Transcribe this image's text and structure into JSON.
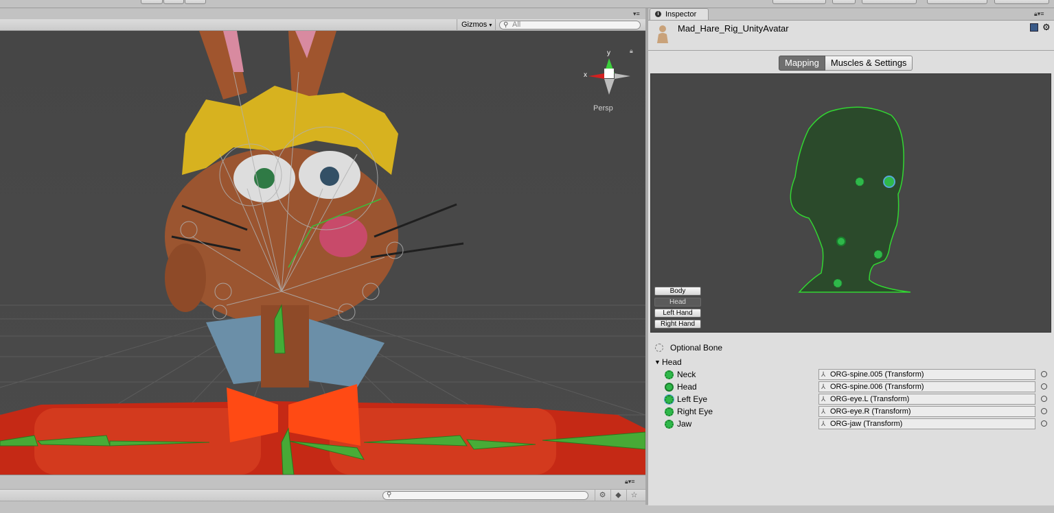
{
  "scene": {
    "gizmos_label": "Gizmos",
    "search_placeholder": "All",
    "persp_label": "Persp",
    "axis_x": "x",
    "axis_y": "y"
  },
  "inspector": {
    "tab_label": "Inspector",
    "object_name": "Mad_Hare_Rig_UnityAvatar",
    "tabs": [
      "Mapping",
      "Muscles & Settings"
    ],
    "active_tab": "Mapping",
    "body_parts": [
      "Body",
      "Head",
      "Left Hand",
      "Right Hand"
    ],
    "active_body_part": "Head",
    "optional_bone_label": "Optional Bone",
    "group_label": "Head",
    "bones": [
      {
        "label": "Neck",
        "value": "ORG-spine.005 (Transform)"
      },
      {
        "label": "Head",
        "value": "ORG-spine.006 (Transform)"
      },
      {
        "label": "Left Eye",
        "value": "ORG-eye.L (Transform)"
      },
      {
        "label": "Right Eye",
        "value": "ORG-eye.R (Transform)"
      },
      {
        "label": "Jaw",
        "value": "ORG-jaw (Transform)"
      }
    ]
  },
  "colors": {
    "accent_green": "#2fb84a",
    "selected_blue": "#57a7d8",
    "viewport_bg": "#464646"
  }
}
